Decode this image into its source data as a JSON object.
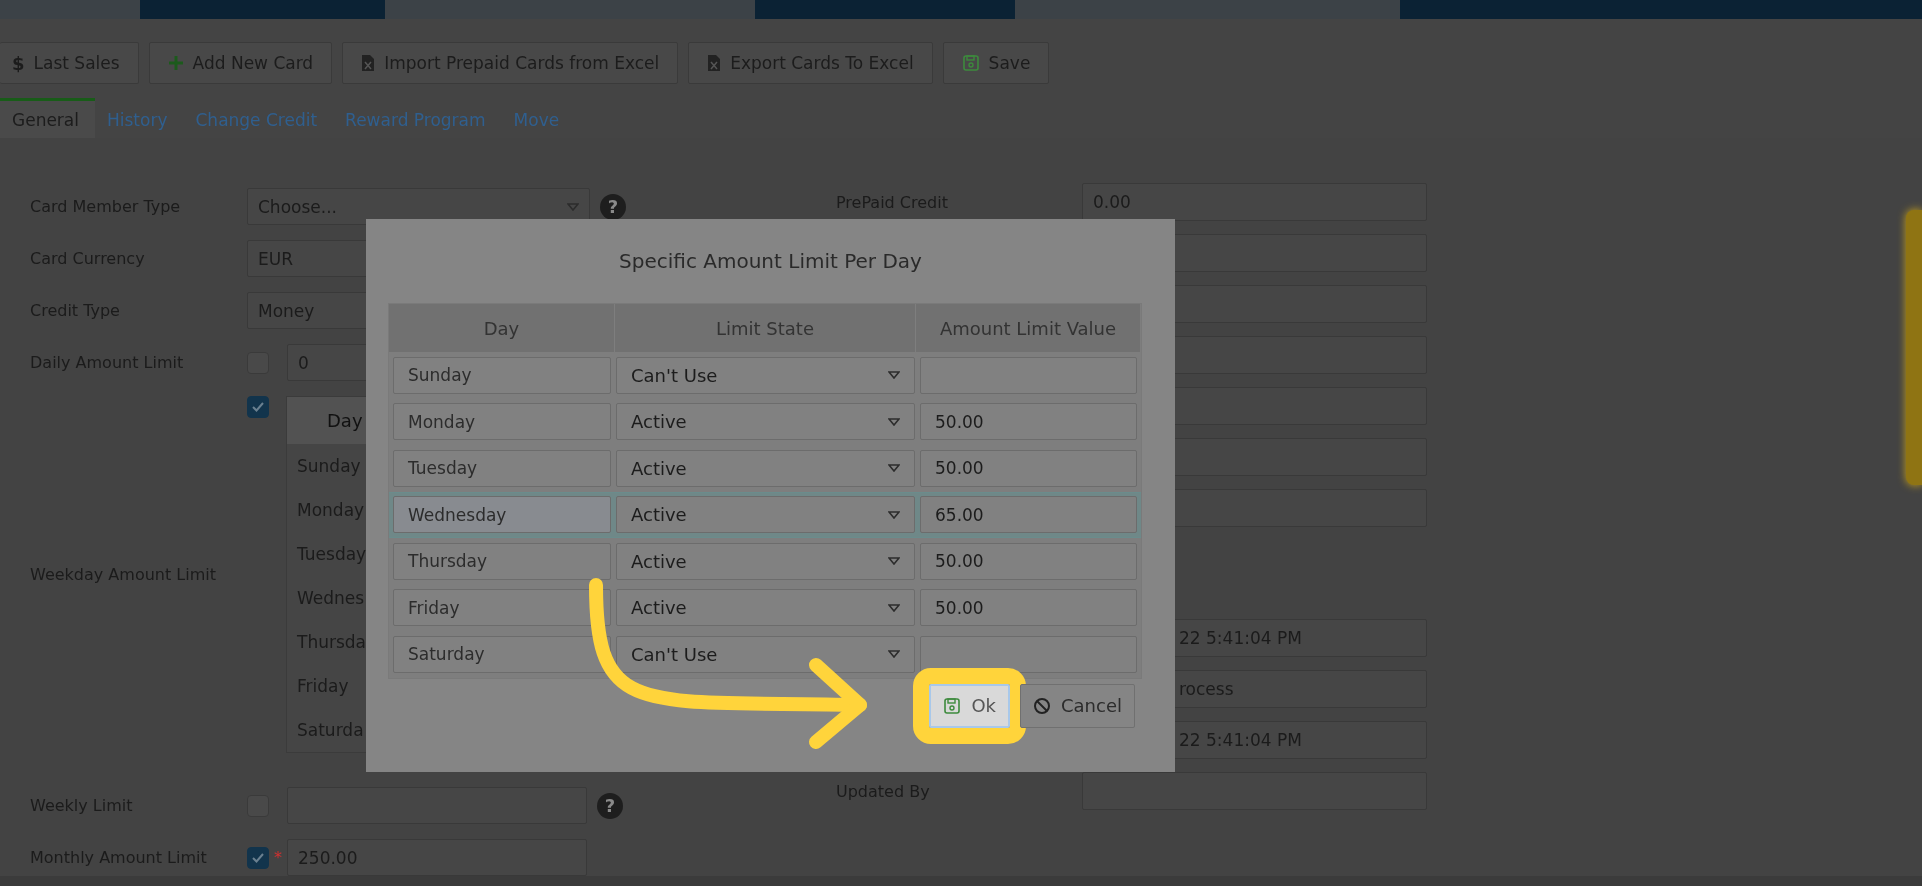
{
  "toolbar": [
    {
      "glyph": "$",
      "label": "Last Sales"
    },
    {
      "label": "Add New Card"
    },
    {
      "label": "Import Prepaid Cards from Excel"
    },
    {
      "label": "Export Cards To Excel"
    },
    {
      "label": "Save"
    }
  ],
  "tabs": [
    {
      "label": "General",
      "selected": true
    },
    {
      "label": "History",
      "selected": false
    },
    {
      "label": "Change Credit",
      "selected": false
    },
    {
      "label": "Reward Program",
      "selected": false
    },
    {
      "label": "Move",
      "selected": false
    }
  ],
  "left_fields": [
    {
      "kind": "select",
      "label": "Card Member Type",
      "value": "Choose...",
      "help_glyph": "?"
    },
    {
      "kind": "text",
      "label": "Card Currency",
      "value": "EUR"
    },
    {
      "kind": "text",
      "label": "Credit Type",
      "value": "Money"
    },
    {
      "kind": "check",
      "label": "Daily Amount Limit",
      "checked": false,
      "value": "0"
    },
    {
      "kind": "weekday",
      "label": "Weekday Amount Limit",
      "checked": true,
      "header": "Day",
      "days": [
        "Sunday",
        "Monday",
        "Tuesday",
        "Wednes",
        "Thursda",
        "Friday",
        "Saturda"
      ]
    },
    {
      "kind": "check",
      "label": "Weekly Limit",
      "checked": false,
      "help_glyph": "?"
    },
    {
      "kind": "check",
      "label": "Monthly Amount Limit",
      "checked": true,
      "required_mark": "*",
      "value": "250.00"
    }
  ],
  "right_fields": [
    {
      "label": "PrePaid Credit",
      "value": "0.00"
    },
    {
      "value": "22 5:41:04 PM"
    },
    {
      "value": "rocess"
    },
    {
      "value": "22 5:41:04 PM"
    },
    {
      "label": "Updated By"
    }
  ],
  "dialog": {
    "title": "Specific Amount Limit Per Day",
    "columns": [
      "Day",
      "Limit State",
      "Amount Limit Value"
    ],
    "rows": [
      {
        "day": "Sunday",
        "state": "Can't Use",
        "selected": false
      },
      {
        "day": "Monday",
        "state": "Active",
        "amount": "50.00",
        "selected": false
      },
      {
        "day": "Tuesday",
        "state": "Active",
        "amount": "50.00",
        "selected": false
      },
      {
        "day": "Wednesday",
        "state": "Active",
        "amount": "65.00",
        "selected": true
      },
      {
        "day": "Thursday",
        "state": "Active",
        "amount": "50.00",
        "selected": false
      },
      {
        "day": "Friday",
        "state": "Active",
        "amount": "50.00",
        "selected": false
      },
      {
        "day": "Saturday",
        "state": "Can't Use",
        "selected": false
      }
    ],
    "buttons": [
      {
        "label": "Ok",
        "highlighted": true
      },
      {
        "label": "Cancel",
        "highlighted": false
      }
    ]
  }
}
